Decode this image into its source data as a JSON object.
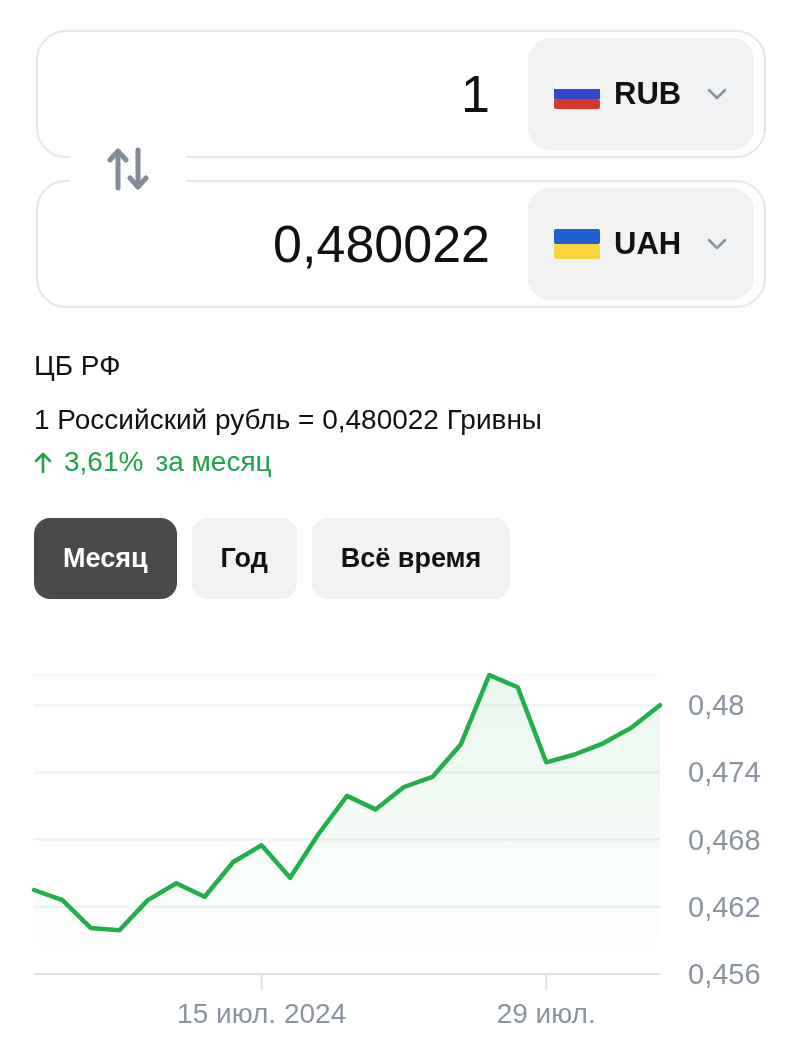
{
  "converter": [
    {
      "amount": "1",
      "currency": "RUB",
      "kind": "ru"
    },
    {
      "amount": "0,480022",
      "currency": "UAH",
      "kind": "ua"
    }
  ],
  "source": "ЦБ РФ",
  "rate_text": "1 Российский рубль = 0,480022 Гривны",
  "change": {
    "kind": "up",
    "value": "3,61%",
    "period": "за месяц"
  },
  "periods": [
    {
      "label": "Месяц",
      "selected": true
    },
    {
      "label": "Год",
      "selected": false
    },
    {
      "label": "Всё время",
      "selected": false
    }
  ],
  "chart_data": {
    "type": "area",
    "categories": [
      null,
      null,
      null,
      null,
      null,
      null,
      null,
      null,
      "15 июл. 2024",
      null,
      null,
      null,
      null,
      null,
      null,
      null,
      null,
      null,
      "29 июл.",
      null,
      null,
      null,
      null
    ],
    "series": [
      {
        "color": "#1fb04a",
        "values": [
          0.4635,
          0.4626,
          0.4601,
          0.4599,
          0.4626,
          0.4641,
          0.4629,
          0.466,
          0.4675,
          0.4646,
          0.4685,
          0.4719,
          0.4707,
          0.4727,
          0.4736,
          0.4765,
          0.4827,
          0.4816,
          0.4749,
          0.4756,
          0.4766,
          0.478,
          0.48
        ]
      }
    ],
    "ylim": [
      0.456,
      0.4827
    ],
    "grid": true,
    "yticks": [
      {
        "value": 0.48,
        "label": "0,48"
      },
      {
        "value": 0.474,
        "label": "0,474"
      },
      {
        "value": 0.468,
        "label": "0,468"
      },
      {
        "value": 0.462,
        "label": "0,462"
      },
      {
        "value": 0.456,
        "label": "0,456"
      }
    ]
  }
}
